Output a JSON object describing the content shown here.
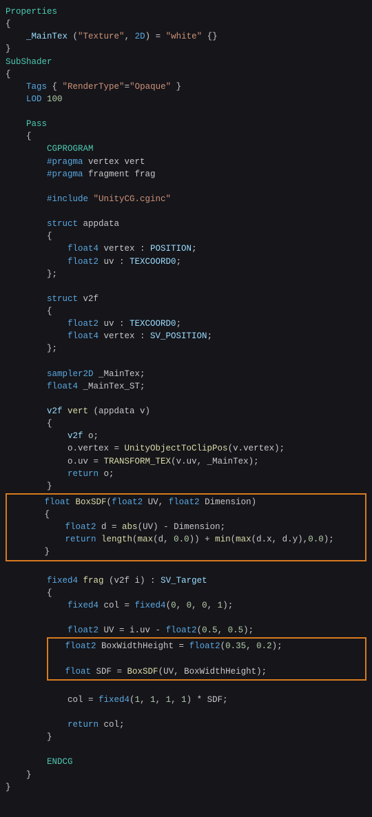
{
  "code": {
    "l1a": "Properties",
    "l2": "{",
    "l3a": "_MainTex",
    "l3b": " (",
    "l3c": "\"Texture\"",
    "l3d": ", ",
    "l3e": "2D",
    "l3f": ") = ",
    "l3g": "\"white\"",
    "l3h": " {}",
    "l4": "}",
    "l5": "SubShader",
    "l6": "{",
    "l7a": "Tags",
    "l7b": " { ",
    "l7c": "\"RenderType\"",
    "l7d": "=",
    "l7e": "\"Opaque\"",
    "l7f": " }",
    "l8a": "LOD",
    "l8b": " 100",
    "l9": "Pass",
    "l10": "{",
    "l11": "CGPROGRAM",
    "l12a": "#pragma",
    "l12b": " vertex vert",
    "l13a": "#pragma",
    "l13b": " fragment frag",
    "l14a": "#include",
    "l14b": " \"UnityCG.cginc\"",
    "l15a": "struct",
    "l15b": " appdata",
    "l16": "{",
    "l17a": "float4",
    "l17b": " vertex : ",
    "l17c": "POSITION",
    "l17d": ";",
    "l18a": "float2",
    "l18b": " uv : ",
    "l18c": "TEXCOORD0",
    "l18d": ";",
    "l19": "};",
    "l20a": "struct",
    "l20b": " v2f",
    "l21": "{",
    "l22a": "float2",
    "l22b": " uv : ",
    "l22c": "TEXCOORD0",
    "l22d": ";",
    "l23a": "float4",
    "l23b": " vertex : ",
    "l23c": "SV_POSITION",
    "l23d": ";",
    "l24": "};",
    "l25a": "sampler2D",
    "l25b": " _MainTex;",
    "l26a": "float4",
    "l26b": " _MainTex_ST;",
    "l27a": "v2f ",
    "l27b": "vert",
    "l27c": " (appdata v)",
    "l28": "{",
    "l29a": "v2f",
    "l29b": " o;",
    "l30a": "o.vertex = ",
    "l30b": "UnityObjectToClipPos",
    "l30c": "(v.vertex);",
    "l31a": "o.uv = ",
    "l31b": "TRANSFORM_TEX",
    "l31c": "(v.uv, _MainTex);",
    "l32a": "return",
    "l32b": " o;",
    "l33": "}",
    "box1": {
      "l1a": "float",
      "l1b": " BoxSDF",
      "l1c": "(",
      "l1d": "float2",
      "l1e": " UV, ",
      "l1f": "float2",
      "l1g": " Dimension)",
      "l2": "{",
      "l3a": "float2",
      "l3b": " d = ",
      "l3c": "abs",
      "l3d": "(UV) - Dimension;",
      "l4a": "return",
      "l4b": " length",
      "l4c": "(",
      "l4d": "max",
      "l4e": "(d, ",
      "l4f": "0.0",
      "l4g": ")) + ",
      "l4h": "min",
      "l4i": "(",
      "l4j": "max",
      "l4k": "(d.x, d.y),",
      "l4l": "0.0",
      "l4m": ");",
      "l5": "}"
    },
    "l34a": "fixed4",
    "l34b": " frag",
    "l34c": " (v2f i) : ",
    "l34d": "SV_Target",
    "l35": "{",
    "l36a": "fixed4",
    "l36b": " col = ",
    "l36c": "fixed4",
    "l36d": "(",
    "l36e": "0",
    "l36f": ", ",
    "l36g": "0",
    "l36h": ", ",
    "l36i": "0",
    "l36j": ", ",
    "l36k": "1",
    "l36l": ");",
    "l37a": "float2",
    "l37b": " UV = i.uv - ",
    "l37c": "float2",
    "l37d": "(",
    "l37e": "0.5",
    "l37f": ", ",
    "l37g": "0.5",
    "l37h": ");",
    "box2": {
      "l1a": "float2",
      "l1b": " BoxWidthHeight = ",
      "l1c": "float2",
      "l1d": "(",
      "l1e": "0.35",
      "l1f": ", ",
      "l1g": "0.2",
      "l1h": ");",
      "l2a": "float",
      "l2b": " SDF = ",
      "l2c": "BoxSDF",
      "l2d": "(UV, BoxWidthHeight);"
    },
    "l38a": "col = ",
    "l38b": "fixed4",
    "l38c": "(",
    "l38d": "1",
    "l38e": ", ",
    "l38f": "1",
    "l38g": ", ",
    "l38h": "1",
    "l38i": ", ",
    "l38j": "1",
    "l38k": ") * SDF;",
    "l39a": "return",
    "l39b": " col;",
    "l40": "}",
    "l41": "ENDCG",
    "l42": "}",
    "l43": "}"
  }
}
